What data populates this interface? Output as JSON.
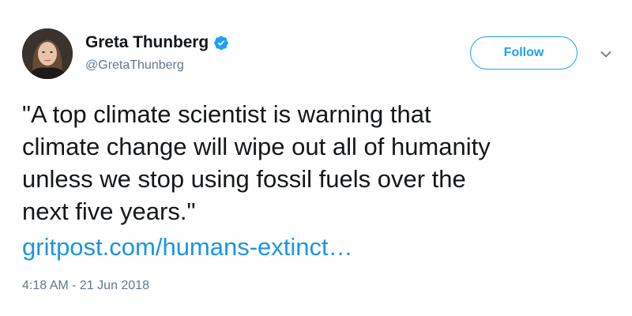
{
  "tweet": {
    "user": {
      "display_name": "Greta Thunberg",
      "handle": "@GretaThunberg",
      "verified": true,
      "verified_icon": "verified-badge-icon",
      "avatar_icon": "avatar-photo"
    },
    "follow_button_label": "Follow",
    "menu_icon": "chevron-down-icon",
    "text": "\"A top climate scientist is warning that\nclimate change will wipe out all of humanity\nunless we stop using fossil fuels over the\nnext five years.\"",
    "link_text": "gritpost.com/humans-extinct…",
    "timestamp": "4:18 AM - 21 Jun 2018"
  },
  "colors": {
    "accent": "#1da1f2",
    "link": "#1b95e0",
    "text": "#14171a",
    "muted": "#657786"
  }
}
